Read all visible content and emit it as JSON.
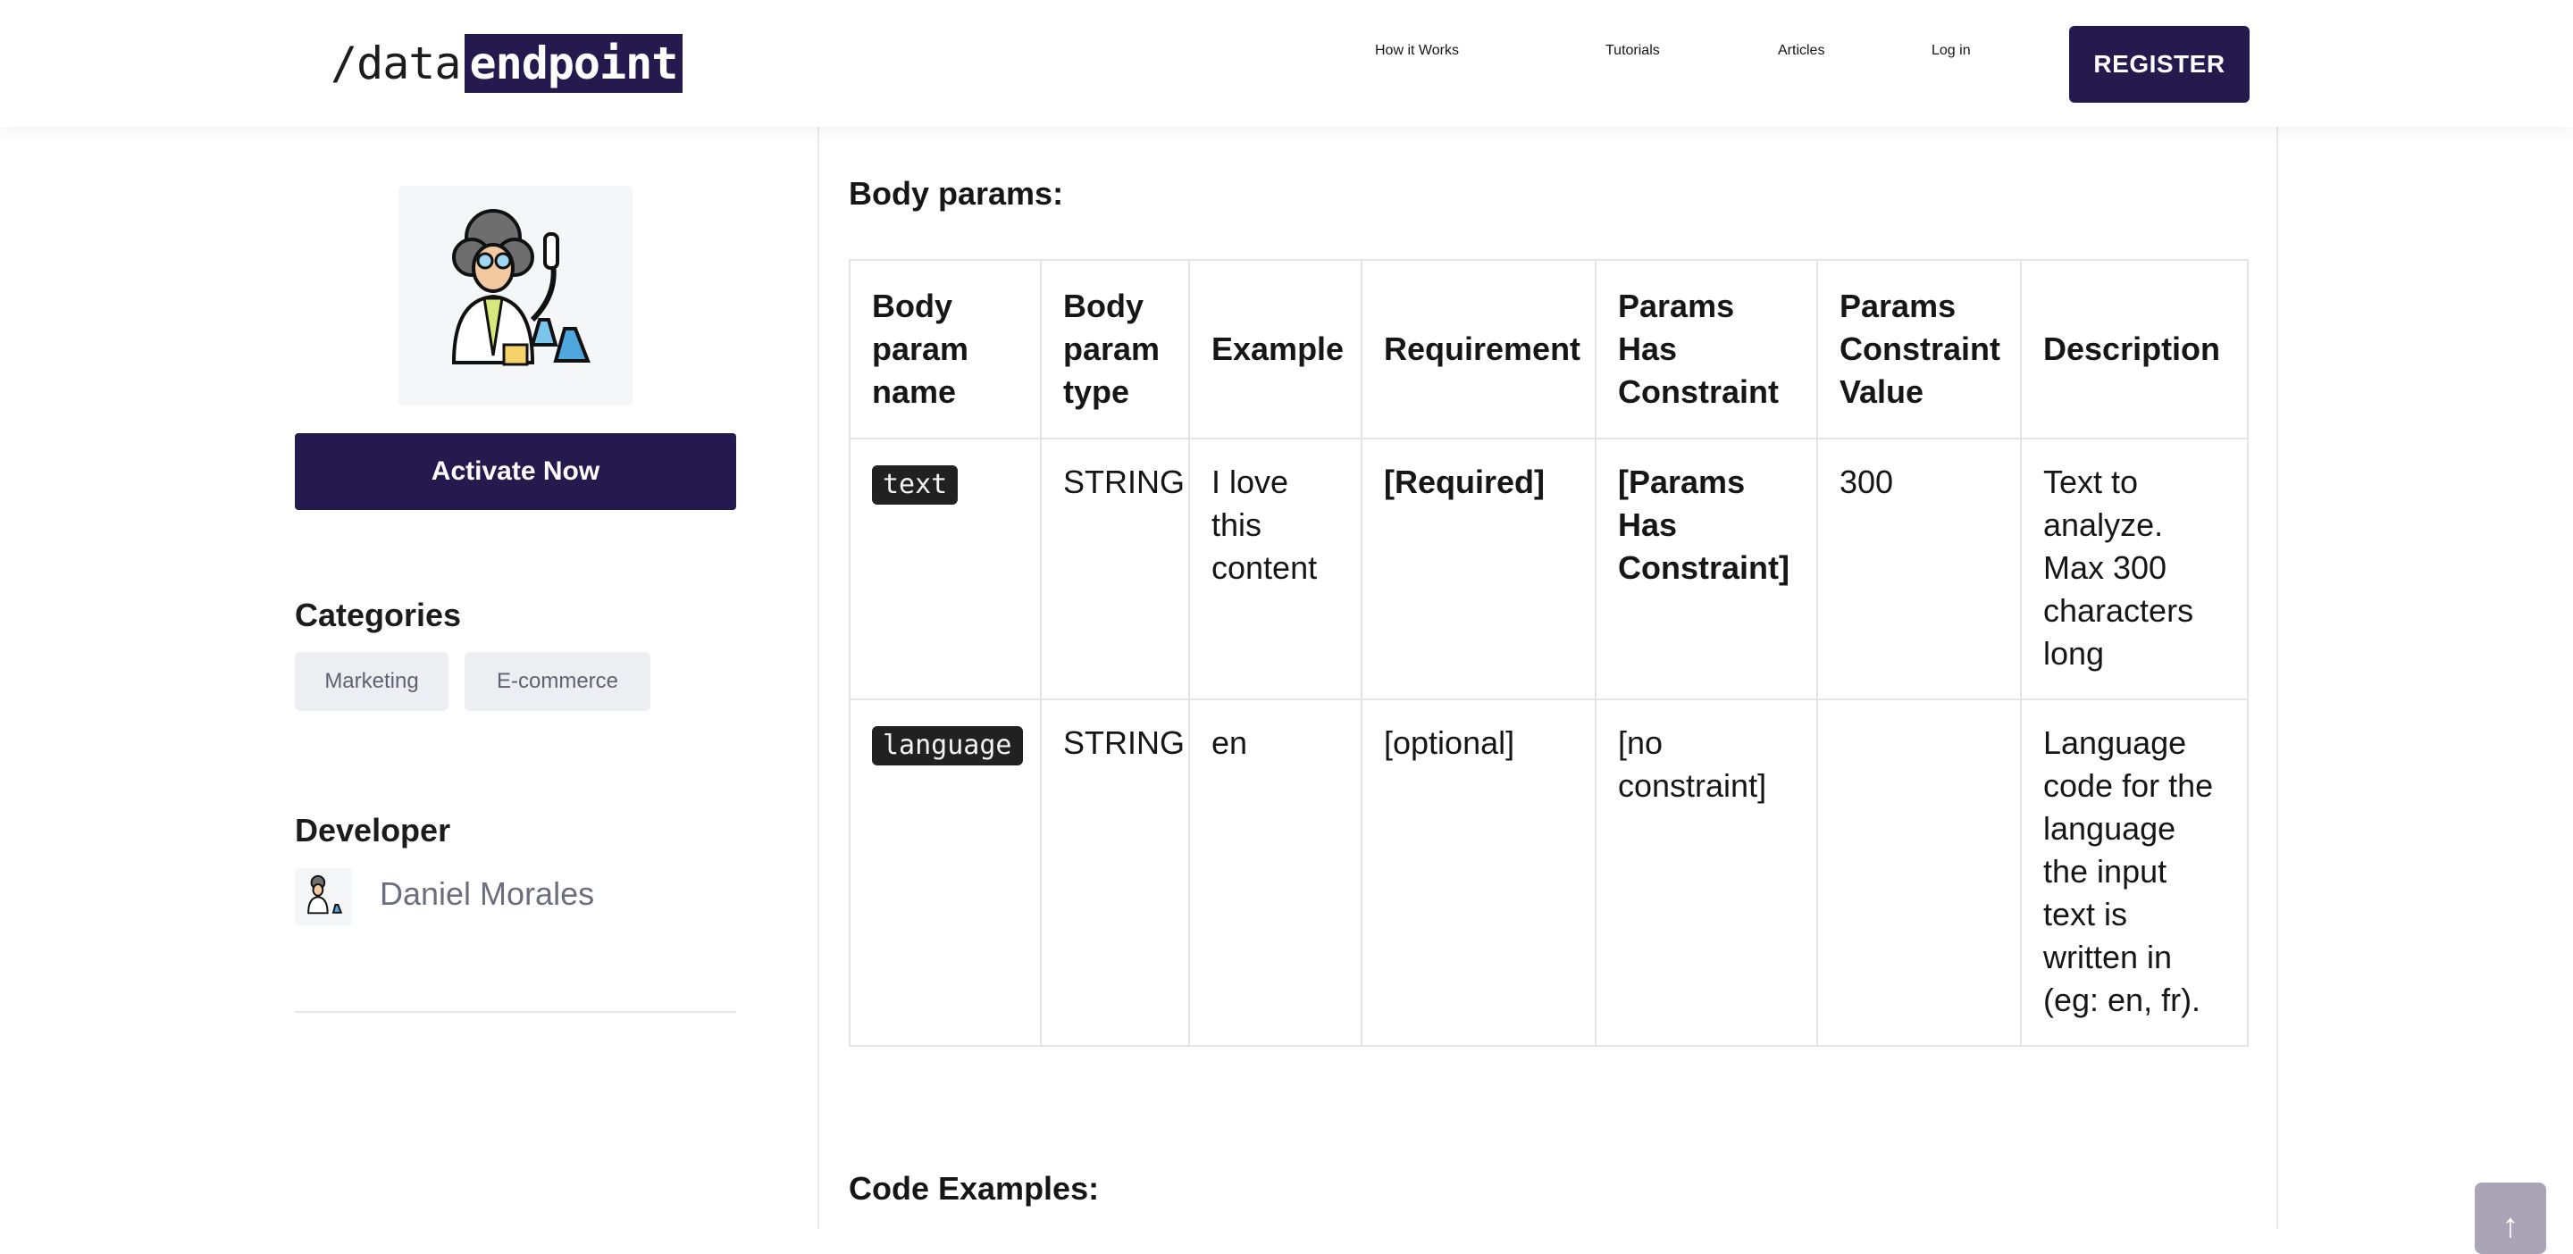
{
  "header": {
    "logo": {
      "prefix": "/data",
      "highlight": "endpoint"
    },
    "nav": [
      "How it Works",
      "Tutorials",
      "Articles",
      "Log in"
    ],
    "register_label": "REGISTER"
  },
  "sidebar": {
    "activate_label": "Activate Now",
    "categories_heading": "Categories",
    "categories": [
      "Marketing",
      "E-commerce"
    ],
    "developer_heading": "Developer",
    "developer_name": "Daniel Morales"
  },
  "main": {
    "body_params_title": "Body params:",
    "table": {
      "headers": [
        "Body param name",
        "Body param type",
        "Example",
        "Requirement",
        "Params Has Constraint",
        "Params Constraint Value",
        "Description"
      ],
      "rows": [
        {
          "name": "text",
          "type": "STRING",
          "example": "I love this content",
          "requirement": "[Required]",
          "constraint": "[Params Has Constraint]",
          "constraint_value": "300",
          "description": "Text to analyze. Max 300 characters long"
        },
        {
          "name": "language",
          "type": "STRING",
          "example": "en",
          "requirement": "[optional]",
          "constraint": "[no constraint]",
          "constraint_value": "",
          "description": "Language code for the language the input text is written in (eg: en, fr)."
        }
      ]
    },
    "code_examples_title": "Code Examples:"
  },
  "icons": {
    "avatar": "scientist-avatar-icon",
    "scroll_top": "arrow-up-icon"
  },
  "colors": {
    "brand": "#241a4e",
    "muted_text": "#6b6e7d",
    "chip_bg": "#eceef1",
    "code_bg": "#212121"
  }
}
